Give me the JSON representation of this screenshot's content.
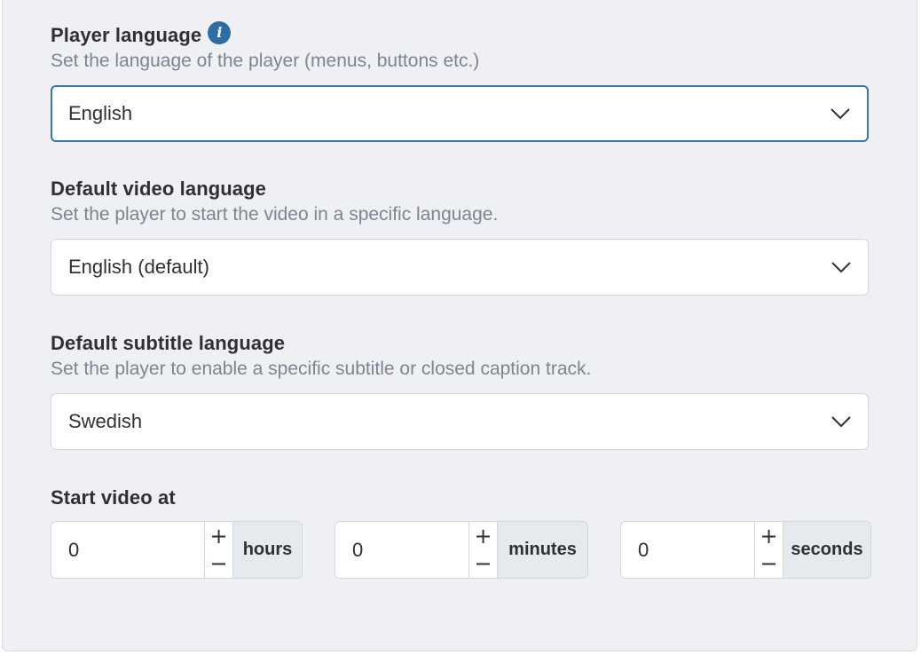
{
  "player_language": {
    "label": "Player language",
    "info_icon": "i",
    "help": "Set the language of the player (menus, buttons etc.)",
    "value": "English"
  },
  "video_language": {
    "label": "Default video language",
    "help": "Set the player to start the video in a specific language.",
    "value": "English (default)"
  },
  "subtitle_language": {
    "label": "Default subtitle language",
    "help": "Set the player to enable a specific subtitle or closed caption track.",
    "value": "Swedish"
  },
  "start_at": {
    "label": "Start video at",
    "increment": "+",
    "decrement": "−",
    "hours": {
      "value": "0",
      "unit": "hours"
    },
    "minutes": {
      "value": "0",
      "unit": "minutes"
    },
    "seconds": {
      "value": "0",
      "unit": "seconds"
    }
  },
  "icons": {
    "info": "info-icon",
    "chevron": "chevron-down-icon"
  },
  "colors": {
    "accent": "#3a76a8",
    "info_icon_bg": "#2e6da4",
    "panel_bg": "#eef0f3",
    "help_text": "#7c8591"
  }
}
